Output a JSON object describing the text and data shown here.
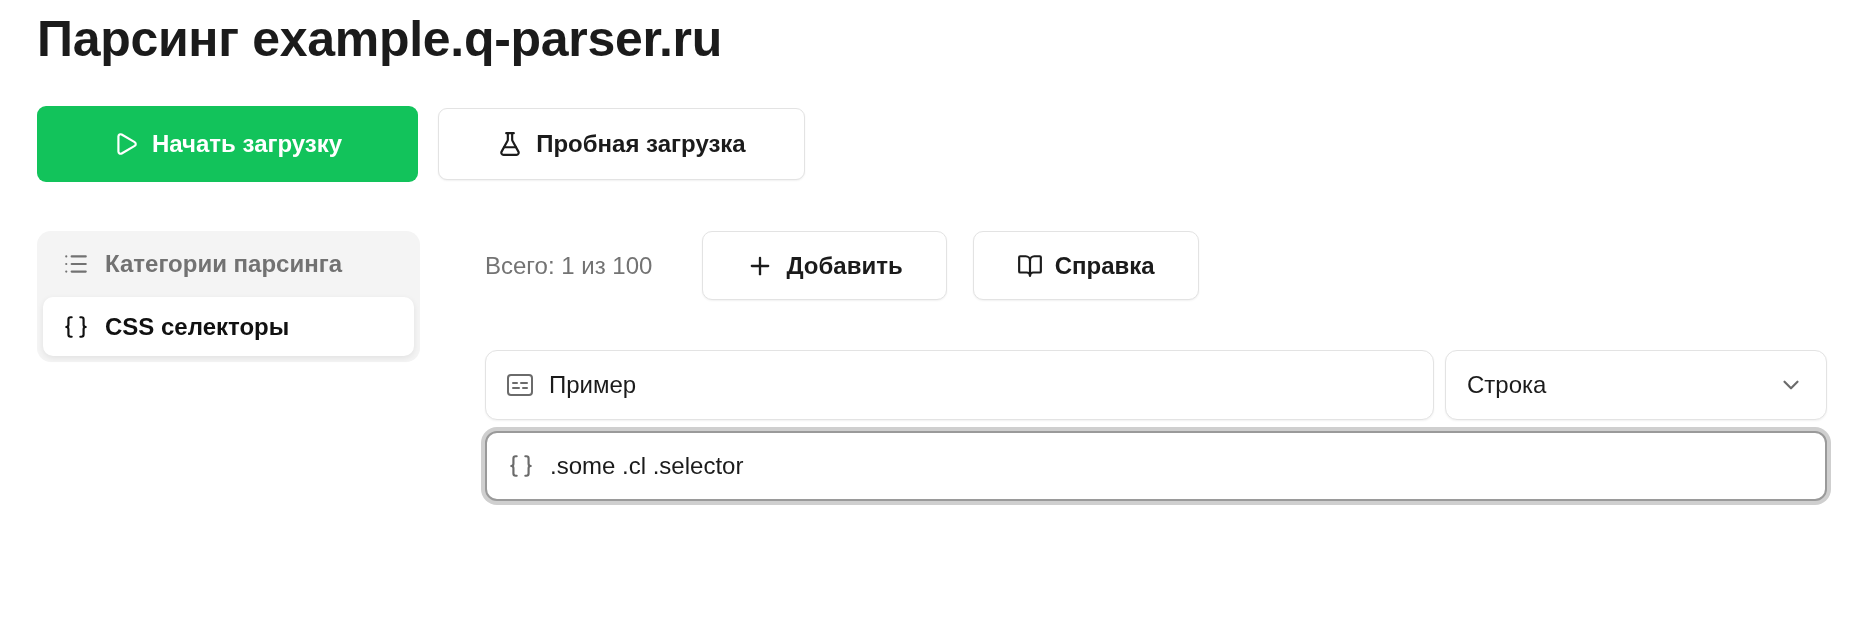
{
  "page": {
    "title": "Парсинг example.q-parser.ru"
  },
  "actions": [
    {
      "label": "Начать загрузку",
      "kind": "primary"
    },
    {
      "label": "Пробная загрузка",
      "kind": "secondary"
    }
  ],
  "sidebar": {
    "title": "Категории парсинга",
    "items": [
      {
        "label": "CSS селекторы",
        "selected": true
      }
    ]
  },
  "toolbar": {
    "count": "Всего: 1 из 100",
    "buttons": [
      {
        "label": "Добавить"
      },
      {
        "label": "Справка"
      }
    ]
  },
  "form": {
    "name_field": {
      "value": "Пример"
    },
    "type_select": {
      "value": "Строка"
    },
    "selector_field": {
      "value": ".some .cl .selector",
      "focused": true
    }
  }
}
